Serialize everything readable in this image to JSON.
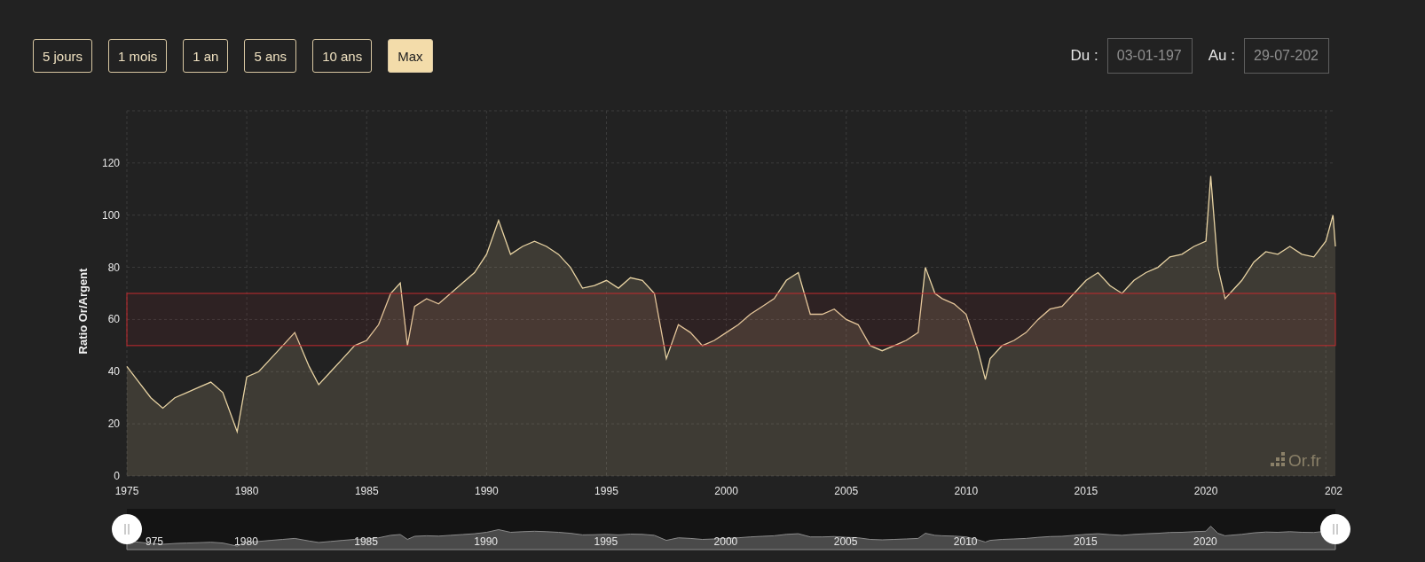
{
  "range_buttons": [
    {
      "label": "5 jours",
      "selected": false
    },
    {
      "label": "1 mois",
      "selected": false
    },
    {
      "label": "1 an",
      "selected": false
    },
    {
      "label": "5 ans",
      "selected": false
    },
    {
      "label": "10 ans",
      "selected": false
    },
    {
      "label": "Max",
      "selected": true
    }
  ],
  "date_range": {
    "from_label": "Du :",
    "from_value": "03-01-197",
    "to_label": "Au :",
    "to_value": "29-07-202"
  },
  "chart": {
    "credit": "Or.fr",
    "cut_tick_label": "202",
    "chart_data": {
      "type": "area",
      "ylabel": "Ratio Or/Argent",
      "grid": true,
      "x": [
        1975,
        1975.5,
        1976,
        1976.5,
        1977,
        1977.5,
        1978,
        1978.5,
        1979,
        1979.6,
        1980,
        1980.5,
        1981,
        1981.5,
        1982,
        1982.6,
        1983,
        1983.5,
        1984,
        1984.5,
        1985,
        1985.5,
        1986,
        1986.4,
        1986.7,
        1987,
        1987.5,
        1988,
        1988.5,
        1989,
        1989.5,
        1990,
        1990.5,
        1991,
        1991.5,
        1992,
        1992.5,
        1993,
        1993.5,
        1994,
        1994.5,
        1995,
        1995.5,
        1996,
        1996.5,
        1997,
        1997.5,
        1998,
        1998.5,
        1999,
        1999.5,
        2000,
        2000.5,
        2001,
        2001.5,
        2002,
        2002.5,
        2003,
        2003.5,
        2004,
        2004.5,
        2005,
        2005.5,
        2006,
        2006.5,
        2007,
        2007.5,
        2008,
        2008.3,
        2008.7,
        2009,
        2009.5,
        2010,
        2010.5,
        2010.8,
        2011,
        2011.5,
        2012,
        2012.5,
        2013,
        2013.5,
        2014,
        2014.5,
        2015,
        2015.5,
        2016,
        2016.5,
        2017,
        2017.5,
        2018,
        2018.5,
        2019,
        2019.5,
        2020,
        2020.2,
        2020.5,
        2020.8,
        2021,
        2021.5,
        2022,
        2022.5,
        2023,
        2023.5,
        2024,
        2024.5,
        2025,
        2025.3,
        2025.4
      ],
      "series": [
        {
          "color": "#e8d3a3",
          "values": [
            42,
            36,
            30,
            26,
            30,
            32,
            34,
            36,
            32,
            17,
            38,
            40,
            45,
            50,
            55,
            42,
            35,
            40,
            45,
            50,
            52,
            58,
            70,
            74,
            50,
            65,
            68,
            66,
            70,
            74,
            78,
            85,
            98,
            85,
            88,
            90,
            88,
            85,
            80,
            72,
            73,
            75,
            72,
            76,
            75,
            70,
            45,
            58,
            55,
            50,
            52,
            55,
            58,
            62,
            65,
            68,
            75,
            78,
            62,
            62,
            64,
            60,
            58,
            50,
            48,
            50,
            52,
            55,
            80,
            70,
            68,
            66,
            62,
            48,
            37,
            45,
            50,
            52,
            55,
            60,
            64,
            65,
            70,
            75,
            78,
            73,
            70,
            75,
            78,
            80,
            84,
            85,
            88,
            90,
            115,
            80,
            68,
            70,
            75,
            82,
            86,
            85,
            88,
            85,
            84,
            90,
            100,
            88
          ]
        }
      ],
      "xlim": [
        1975,
        2025.4
      ],
      "ylim": [
        0,
        140
      ],
      "yticks": [
        0,
        20,
        40,
        60,
        80,
        100,
        120
      ],
      "xticks": [
        1975,
        1980,
        1985,
        1990,
        1995,
        2000,
        2005,
        2010,
        2015,
        2020
      ],
      "bands": [
        {
          "axis": "y",
          "from": 50,
          "to": 70,
          "color": "#c42a2f"
        }
      ]
    }
  },
  "navigator": {
    "labels": [
      "975",
      "1980",
      "1985",
      "1990",
      "1995",
      "2000",
      "2005",
      "2010",
      "2015",
      "2020"
    ]
  }
}
